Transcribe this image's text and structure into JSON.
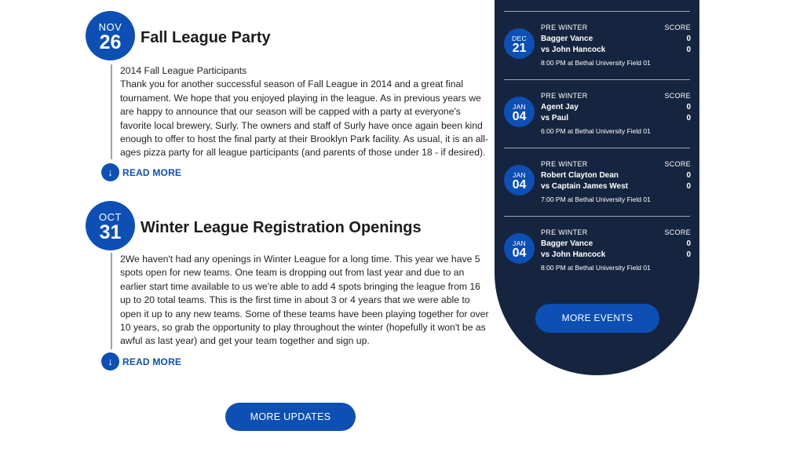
{
  "posts": [
    {
      "month": "NOV",
      "day": "26",
      "title": "Fall League Party",
      "body": [
        "2014 Fall League Participants",
        "Thank you for another successful season of Fall League in 2014 and a great final tournament. We hope that you enjoyed playing in the league. As in previous years we are happy to announce that our season will be capped with a party at everyone's favorite local brewery, Surly. The owners and staff of Surly have once again been kind enough to offer to host the final party at their Brooklyn Park facility. As usual, it is an all-ages pizza party for all league participants (and parents of those under 18 - if desired). There will be pizza and soda"
      ],
      "read_more": "READ MORE"
    },
    {
      "month": "OCT",
      "day": "31",
      "title": "Winter League Registration Openings",
      "body": [
        "2We haven't had any openings in Winter League for a long time. This year we have 5 spots open for new teams. One team is dropping out from last year and due to an earlier start time available to us we're able to add 4 spots bringing the league from 16 up to 20 total teams. This is the first time in about 3 or 4 years that we were able to open it up to any new teams. Some of these teams have been playing together for over 10 years, so grab the opportunity to play throughout the winter (hopefully it won't be as awful as last year) and get your team together and sign up."
      ],
      "read_more": "READ MORE"
    }
  ],
  "more_updates_label": "MORE UPDATES",
  "events": [
    {
      "month": "DEC",
      "day": "21",
      "league": "PRE WINTER",
      "score_label": "SCORE",
      "team1": "Bagger Vance",
      "team2": "vs John Hancock",
      "score1": "0",
      "score2": "0",
      "info": "8:00 PM at Bethal University Field 01"
    },
    {
      "month": "JAN",
      "day": "04",
      "league": "PRE WINTER",
      "score_label": "SCORE",
      "team1": "Agent Jay",
      "team2": "vs Paul",
      "score1": "0",
      "score2": "0",
      "info": "6:00 PM at Bethal University Field 01"
    },
    {
      "month": "JAN",
      "day": "04",
      "league": "PRE WINTER",
      "score_label": "SCORE",
      "team1": "Robert Clayton Dean",
      "team2": "vs Captain James West",
      "score1": "0",
      "score2": "0",
      "info": "7:00 PM at Bethal University Field 01"
    },
    {
      "month": "JAN",
      "day": "04",
      "league": "PRE WINTER",
      "score_label": "SCORE",
      "team1": "Bagger Vance",
      "team2": "vs John Hancock",
      "score1": "0",
      "score2": "0",
      "info": "8:00 PM at Bethal University Field 01"
    }
  ],
  "more_events_label": "MORE EVENTS",
  "colors": {
    "accent": "#0d4fb4",
    "panel": "#16253f",
    "text": "#222222"
  },
  "icons": {
    "read_more": "arrow-down-circle-icon"
  }
}
